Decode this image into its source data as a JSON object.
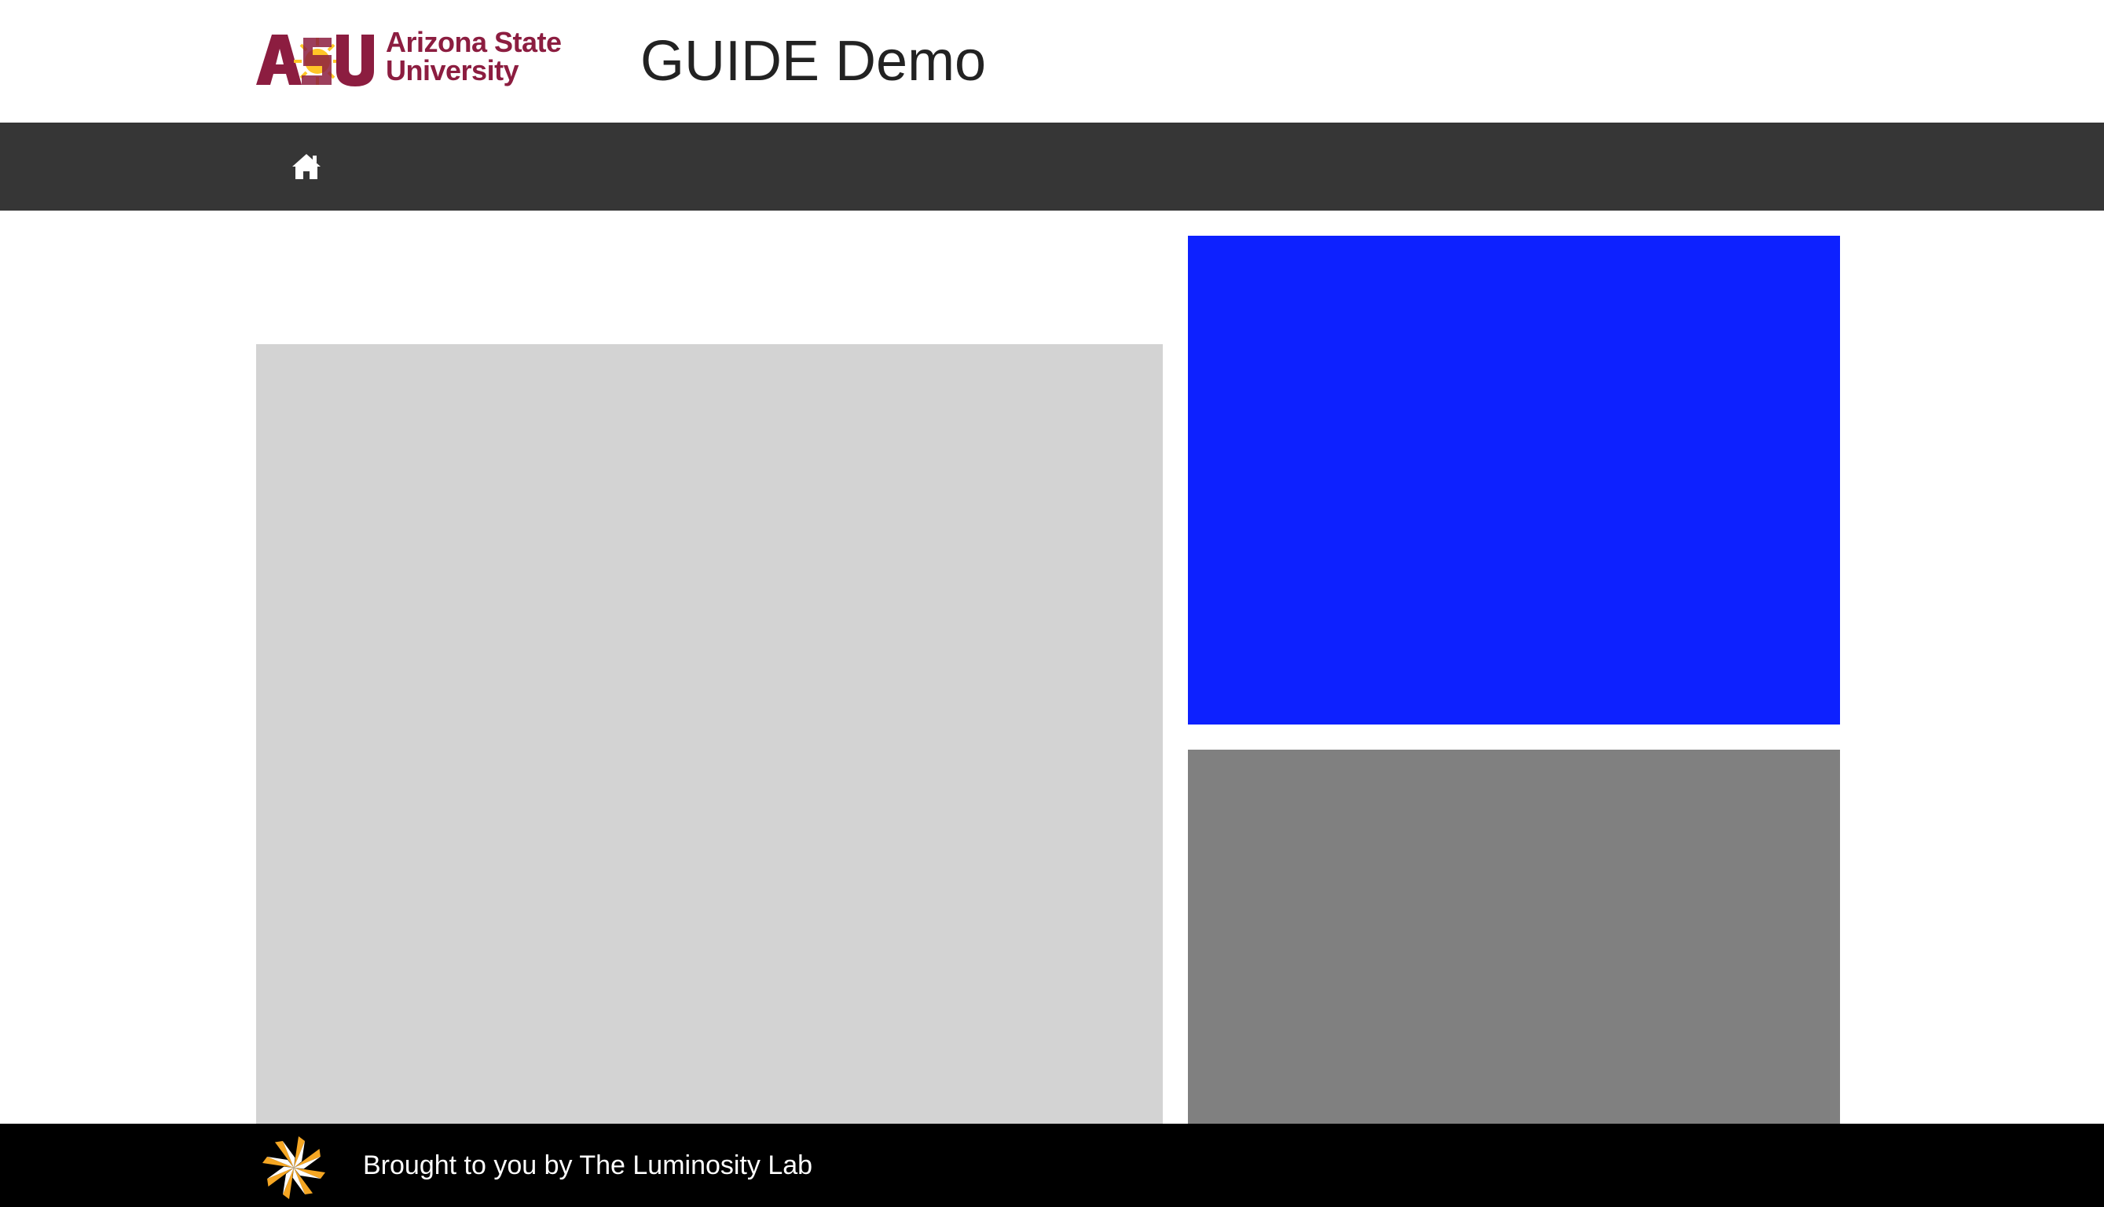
{
  "header": {
    "logo": {
      "wordmark": "ASU",
      "line1": "Arizona State",
      "line2": "University",
      "icon": "asu-sunburst-logo",
      "color": "#8C1D40",
      "accent": "#FFC627"
    },
    "title": "GUIDE Demo"
  },
  "nav": {
    "background": "#363636",
    "home_icon": "home-icon"
  },
  "panels": {
    "left_color": "#D3D3D3",
    "right_top_color": "#0D21FF",
    "right_bottom_color": "#808080"
  },
  "footer": {
    "text": "Brought to you by The Luminosity Lab",
    "logo_icon": "luminosity-lab-logo-icon",
    "logo_color": "#F5A623"
  }
}
